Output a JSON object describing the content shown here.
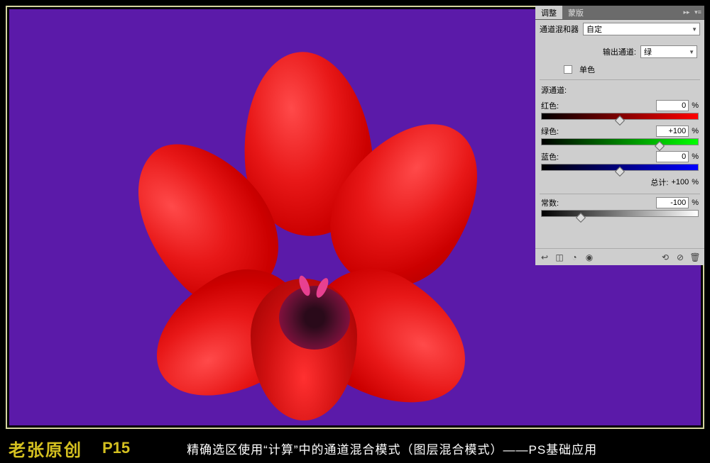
{
  "tabs": {
    "adjust": "调整",
    "mask": "蒙版"
  },
  "panel": {
    "mixer_label": "通道混和器",
    "preset": "自定",
    "output_label": "输出通道:",
    "output_value": "绿",
    "mono_label": "单色",
    "source_label": "源通道:",
    "total_label": "总计:",
    "total_value": "+100",
    "pct": "%"
  },
  "channels": {
    "red": {
      "label": "红色:",
      "value": "0",
      "thumb_pct": 50
    },
    "green": {
      "label": "绿色:",
      "value": "+100",
      "thumb_pct": 75
    },
    "blue": {
      "label": "蓝色:",
      "value": "0",
      "thumb_pct": 50
    }
  },
  "constant": {
    "label": "常数:",
    "value": "-100",
    "thumb_pct": 25
  },
  "footer": {
    "author": "老张原创",
    "page": "P15",
    "title": "精确选区使用“计算”中的通道混合模式（图层混合模式）——PS基础应用"
  }
}
